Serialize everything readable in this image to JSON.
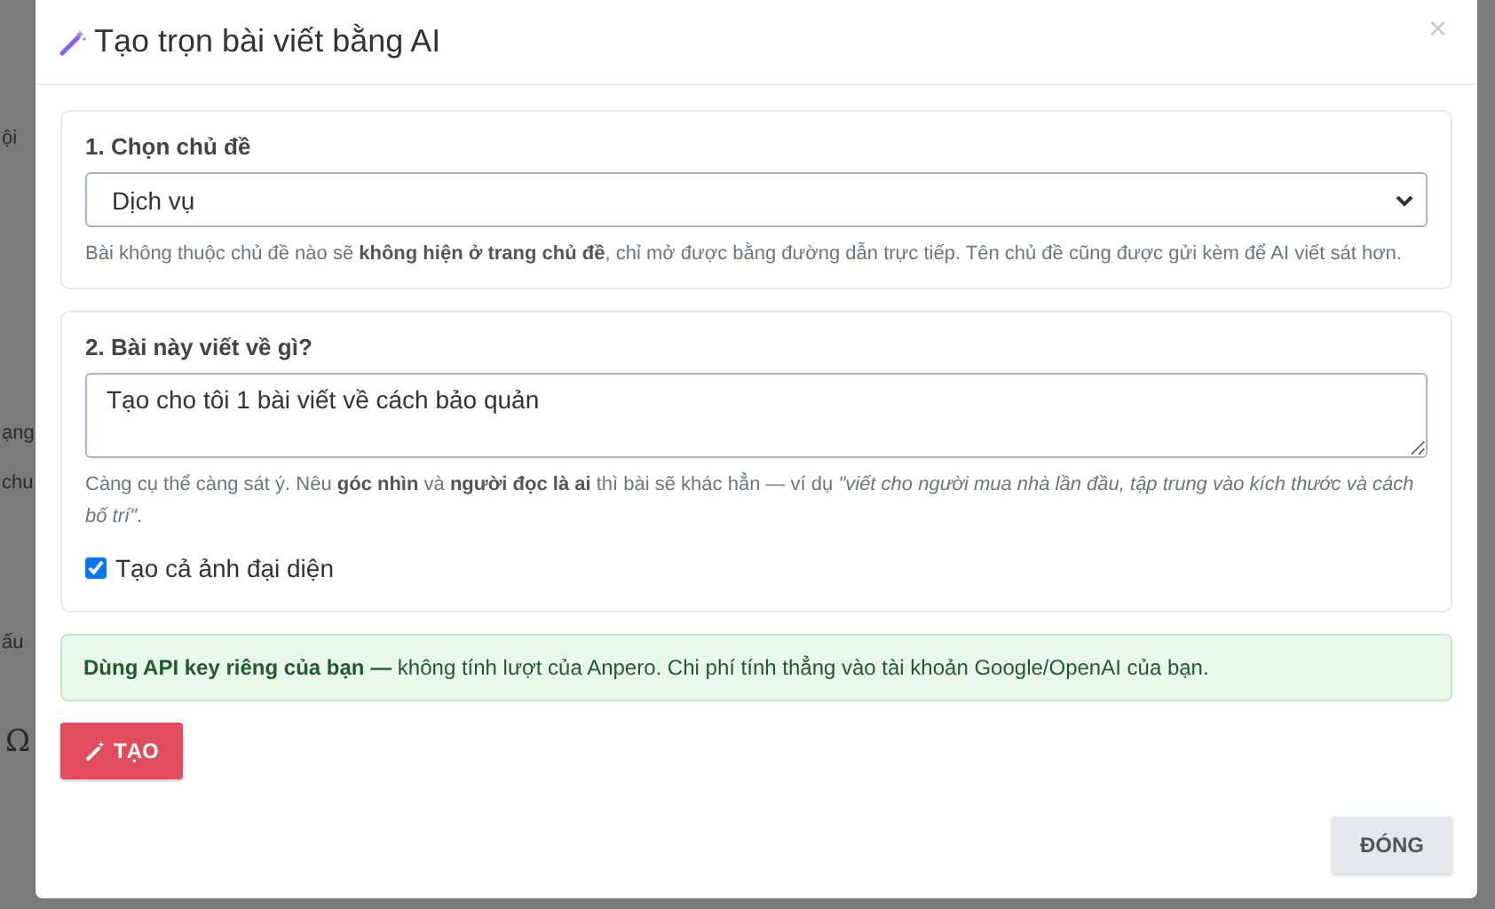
{
  "background_fragments": [
    {
      "text": "ội"
    },
    {
      "text": "ạng"
    },
    {
      "text": "chu"
    },
    {
      "text": "ấu"
    },
    {
      "text": "Ω"
    }
  ],
  "modal": {
    "title": "Tạo trọn bài viết bằng AI",
    "close": "×",
    "topic": {
      "label": "1. Chọn chủ đề",
      "value": "Dịch vụ",
      "help": "Bài không thuộc chủ đề nào sẽ **không hiện ở trang chủ đề**, chỉ mở được bằng đường dẫn trực tiếp. Tên chủ đề cũng được gửi kèm để AI viết sát hơn."
    },
    "prompt": {
      "label": "2. Bài này viết về gì?",
      "value": "Tạo cho tôi 1 bài viết về cách bảo quản",
      "help": "Càng cụ thể càng sát ý. Nêu **góc nhìn** và **người đọc là ai** thì bài sẽ khác hẳn — ví dụ *\"viết cho người mua nhà lần đầu, tập trung vào kích thước và cách bố trí\"*.",
      "checkbox": {
        "label": "Tạo cả ảnh đại diện",
        "checked": true
      }
    },
    "notice": "**Dùng API key riêng của bạn —** không tính lượt của Anpero. Chi phí tính thẳng vào tài khoản Google/OpenAI của bạn.",
    "create_button": "TẠO",
    "close_button": "ĐÓNG"
  }
}
